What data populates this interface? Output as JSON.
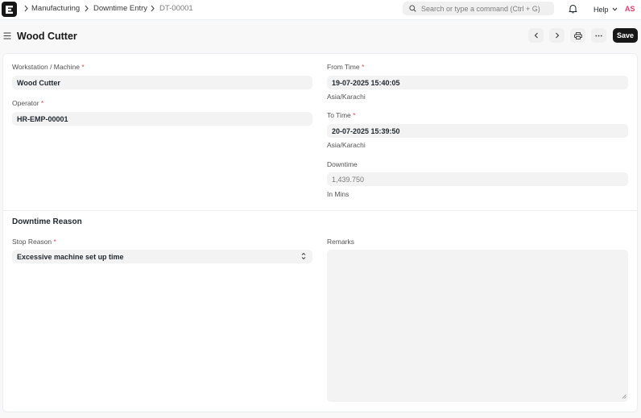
{
  "navbar": {
    "breadcrumbs": [
      "Manufacturing",
      "Downtime Entry",
      "DT-00001"
    ],
    "search_placeholder": "Search or type a command (Ctrl + G)",
    "help_label": "Help",
    "avatar_initials": "AS"
  },
  "page": {
    "title": "Wood Cutter",
    "save_label": "Save"
  },
  "form": {
    "workstation": {
      "label": "Workstation / Machine",
      "required": "*",
      "value": "Wood Cutter"
    },
    "operator": {
      "label": "Operator",
      "required": "*",
      "value": "HR-EMP-00001"
    },
    "from_time": {
      "label": "From Time",
      "required": "*",
      "value": "19-07-2025 15:40:05",
      "timezone": "Asia/Karachi"
    },
    "to_time": {
      "label": "To Time",
      "required": "*",
      "value": "20-07-2025 15:39:50",
      "timezone": "Asia/Karachi"
    },
    "downtime": {
      "label": "Downtime",
      "value": "1,439.750",
      "unit_hint": "In Mins"
    },
    "reason_section": {
      "title": "Downtime Reason",
      "stop_reason": {
        "label": "Stop Reason",
        "required": "*",
        "value": "Excessive machine set up time"
      },
      "remarks": {
        "label": "Remarks",
        "value": ""
      }
    }
  },
  "colors": {
    "accent_dark": "#171717",
    "required_red": "#e24c4c",
    "avatar_pink": "#e03a6d",
    "field_bg": "#f3f3f3"
  },
  "icons": [
    "app-logo-icon",
    "chevron-right-icon",
    "search-icon",
    "bell-icon",
    "chevron-down-icon",
    "hamburger-icon",
    "chevron-left-icon",
    "printer-icon",
    "ellipsis-icon",
    "select-updown-icon",
    "resize-grip-icon"
  ]
}
